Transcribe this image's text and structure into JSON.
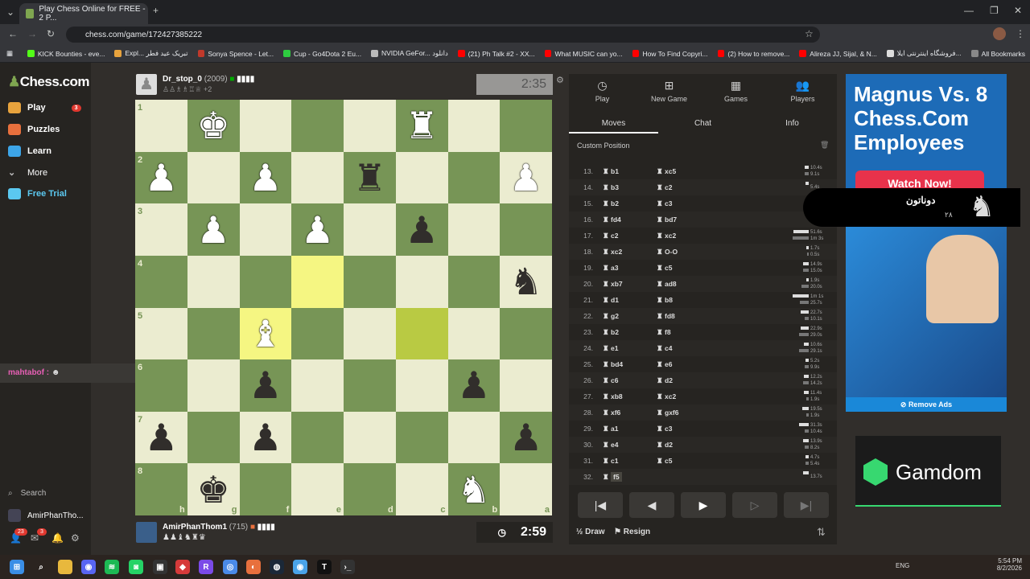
{
  "browser": {
    "tab_title": "Play Chess Online for FREE - 2 P...",
    "url": "chess.com/game/172427385222",
    "bookmarks": [
      {
        "label": "KICK Bounties - eve...",
        "color": "#53fc18"
      },
      {
        "label": "Expl... تبریک عید فطر",
        "color": "#e8a33d"
      },
      {
        "label": "Sonya Spence - Let...",
        "color": "#c0392b"
      },
      {
        "label": "Cup - Go4Dota 2 Eu...",
        "color": "#2ecc40"
      },
      {
        "label": "NVIDIA GeFor... دانلود",
        "color": "#bbbbbb"
      },
      {
        "label": "(21) Ph Talk #2 - XX...",
        "color": "#ff0000"
      },
      {
        "label": "What MUSIC can yo...",
        "color": "#ff0000"
      },
      {
        "label": "How To Find Copyri...",
        "color": "#ff0000"
      },
      {
        "label": "(2) How to remove...",
        "color": "#ff0000"
      },
      {
        "label": "Alireza JJ, Sijal, & N...",
        "color": "#ff0000"
      },
      {
        "label": "فروشگاه اینترنتی ایلا...",
        "color": "#dddddd"
      }
    ],
    "all_bookmarks": "All Bookmarks"
  },
  "sidebar": {
    "logo": "Chess.com",
    "items": [
      {
        "label": "Play",
        "badge": "3",
        "color": "#e8a33d"
      },
      {
        "label": "Puzzles",
        "color": "#e8703d"
      },
      {
        "label": "Learn",
        "color": "#3da5e8"
      },
      {
        "label": "More",
        "color": "#bbbbbb"
      },
      {
        "label": "Free Trial",
        "color": "#5bc8f0"
      }
    ],
    "search": "Search",
    "username": "AmirPhanTho...",
    "notif_badge": "23",
    "msg_badge": "3"
  },
  "chat_popup": {
    "user": "mahtabof :"
  },
  "top_player": {
    "name": "Dr_stop_0",
    "rating": "(2009)",
    "captured_extra": "+2",
    "clock": "2:35"
  },
  "bottom_player": {
    "name": "AmirPhanThom1",
    "rating": "(715)",
    "clock": "2:59"
  },
  "board": {
    "ranks": [
      "1",
      "2",
      "3",
      "4",
      "5",
      "6",
      "7",
      "8"
    ],
    "files": [
      "h",
      "g",
      "f",
      "e",
      "d",
      "c",
      "b",
      "a"
    ],
    "rows": [
      [
        "",
        "wK",
        "",
        "",
        "",
        "wR",
        "",
        ""
      ],
      [
        "wP",
        "",
        "wP",
        "",
        "bR",
        "",
        "",
        "wP"
      ],
      [
        "",
        "wP",
        "",
        "wP",
        "",
        "bP",
        "",
        ""
      ],
      [
        "",
        "",
        "",
        "",
        "",
        "",
        "",
        "bN"
      ],
      [
        "",
        "",
        "wB",
        "",
        "",
        "",
        "",
        ""
      ],
      [
        "",
        "",
        "bP",
        "",
        "",
        "",
        "bP",
        ""
      ],
      [
        "bP",
        "",
        "bP",
        "",
        "",
        "",
        "",
        "bP"
      ],
      [
        "",
        "bK",
        "",
        "",
        "",
        "",
        "wN",
        ""
      ]
    ],
    "highlights": [
      [
        3,
        3
      ],
      [
        4,
        2
      ],
      [
        4,
        5
      ]
    ]
  },
  "panel": {
    "tabs": [
      "Play",
      "New Game",
      "Games",
      "Players"
    ],
    "subtabs": [
      "Moves",
      "Chat",
      "Info"
    ],
    "position_label": "Custom Position",
    "moves": [
      {
        "n": "13.",
        "w": "b1",
        "b": "xc5",
        "tw": "10.4s",
        "tb": "9.1s"
      },
      {
        "n": "14.",
        "w": "b3",
        "b": "c2",
        "tw": "5.4s",
        "tb": ""
      },
      {
        "n": "15.",
        "w": "b2",
        "b": "c3",
        "tw": "",
        "tb": ""
      },
      {
        "n": "16.",
        "w": "fd4",
        "b": "bd7",
        "tw": "",
        "tb": ""
      },
      {
        "n": "17.",
        "w": "c2",
        "b": "xc2",
        "tw": "51.6s",
        "tb": "1m 3s"
      },
      {
        "n": "18.",
        "w": "xc2",
        "b": "O-O",
        "tw": "1.7s",
        "tb": "0.5s"
      },
      {
        "n": "19.",
        "w": "a3",
        "b": "c5",
        "tw": "14.9s",
        "tb": "15.0s"
      },
      {
        "n": "20.",
        "w": "xb7",
        "b": "ad8",
        "tw": "1.9s",
        "tb": "20.0s"
      },
      {
        "n": "21.",
        "w": "d1",
        "b": "b8",
        "tw": "1m 1s",
        "tb": "25.7s"
      },
      {
        "n": "22.",
        "w": "g2",
        "b": "fd8",
        "tw": "22.7s",
        "tb": "10.1s"
      },
      {
        "n": "23.",
        "w": "b2",
        "b": "f8",
        "tw": "22.9s",
        "tb": "29.0s"
      },
      {
        "n": "24.",
        "w": "e1",
        "b": "c4",
        "tw": "10.6s",
        "tb": "29.1s"
      },
      {
        "n": "25.",
        "w": "bd4",
        "b": "e6",
        "tw": "5.2s",
        "tb": "9.9s"
      },
      {
        "n": "26.",
        "w": "c6",
        "b": "d2",
        "tw": "12.2s",
        "tb": "14.2s"
      },
      {
        "n": "27.",
        "w": "xb8",
        "b": "xc2",
        "tw": "11.4s",
        "tb": "1.9s"
      },
      {
        "n": "28.",
        "w": "xf6",
        "b": "gxf6",
        "tw": "19.5s",
        "tb": "1.9s"
      },
      {
        "n": "29.",
        "w": "a1",
        "b": "c3",
        "tw": "31.3s",
        "tb": "10.4s"
      },
      {
        "n": "30.",
        "w": "e4",
        "b": "d2",
        "tw": "13.9s",
        "tb": "8.2s"
      },
      {
        "n": "31.",
        "w": "c1",
        "b": "c5",
        "tw": "4.7s",
        "tb": "5.4s"
      },
      {
        "n": "32.",
        "w": "f5",
        "b": "",
        "tw": "13.7s",
        "tb": ""
      }
    ],
    "draw": "½ Draw",
    "resign": "Resign"
  },
  "ads": {
    "headline": "Magnus Vs. 8 Chess.Com Employees",
    "cta": "Watch Now!",
    "remove": "Remove Ads",
    "overlay_text": "دوناتون",
    "overlay_sub": "۲۸",
    "gamdom": "Gamdom",
    "brand_color": "#37d870"
  },
  "taskbar": {
    "lang": "ENG",
    "time": "5:54 PM",
    "date": "8/2/2026"
  }
}
